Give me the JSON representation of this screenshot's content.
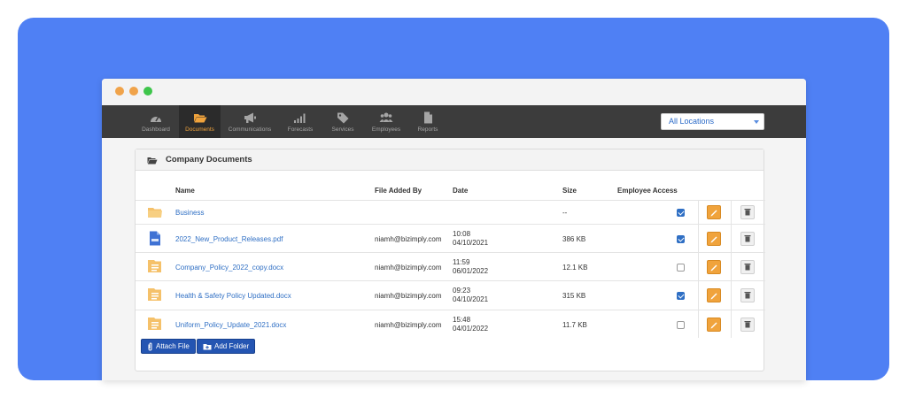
{
  "nav": {
    "items": [
      {
        "label": "Dashboard",
        "icon": "speedometer-icon",
        "active": false
      },
      {
        "label": "Documents",
        "icon": "folder-open-icon",
        "active": true
      },
      {
        "label": "Communications",
        "icon": "megaphone-icon",
        "active": false
      },
      {
        "label": "Forecasts",
        "icon": "signal-bars-icon",
        "active": false
      },
      {
        "label": "Services",
        "icon": "tag-icon",
        "active": false
      },
      {
        "label": "Employees",
        "icon": "users-icon",
        "active": false
      },
      {
        "label": "Reports",
        "icon": "file-icon",
        "active": false
      }
    ]
  },
  "location_select": {
    "value": "All Locations"
  },
  "panel": {
    "title": "Company Documents"
  },
  "table": {
    "headers": {
      "name": "Name",
      "added_by": "File Added By",
      "date": "Date",
      "size": "Size",
      "access": "Employee Access"
    },
    "rows": [
      {
        "type": "folder",
        "name": "Business",
        "added_by": "",
        "time": "",
        "date": "",
        "size": "--",
        "access": true
      },
      {
        "type": "pdf",
        "name": "2022_New_Product_Releases.pdf",
        "added_by": "niamh@bizimply.com",
        "time": "10:08",
        "date": "04/10/2021",
        "size": "386 KB",
        "access": true
      },
      {
        "type": "doc",
        "name": "Company_Policy_2022_copy.docx",
        "added_by": "niamh@bizimply.com",
        "time": "11:59",
        "date": "06/01/2022",
        "size": "12.1 KB",
        "access": false
      },
      {
        "type": "doc",
        "name": "Health & Safety Policy Updated.docx",
        "added_by": "niamh@bizimply.com",
        "time": "09:23",
        "date": "04/10/2021",
        "size": "315 KB",
        "access": true
      },
      {
        "type": "doc",
        "name": "Uniform_Policy_Update_2021.docx",
        "added_by": "niamh@bizimply.com",
        "time": "15:48",
        "date": "04/01/2022",
        "size": "11.7 KB",
        "access": false
      }
    ]
  },
  "actions": {
    "attach_label": "Attach File",
    "add_folder_label": "Add Folder"
  },
  "colors": {
    "frame": "#4f80f4",
    "accent": "#f0a33c",
    "link": "#2f6fc4",
    "button": "#2455b2"
  }
}
